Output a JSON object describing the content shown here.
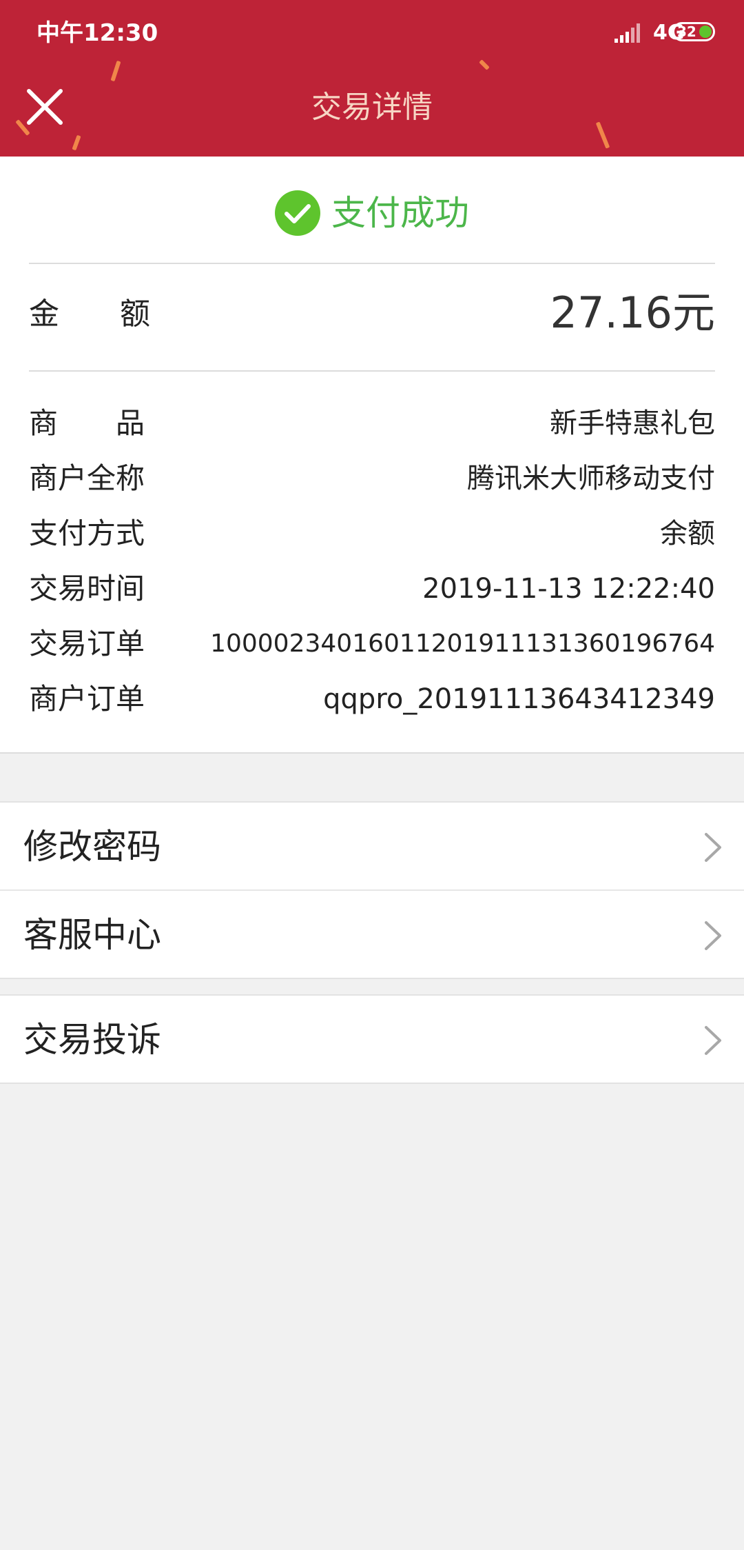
{
  "status_bar": {
    "time": "中午12:30",
    "network": "4G",
    "battery": "32"
  },
  "header": {
    "title": "交易详情",
    "close_icon": "close-icon"
  },
  "result": {
    "icon": "check-circle-icon",
    "text": "支付成功",
    "color": "#4cb64a"
  },
  "amount": {
    "label": "金　　额",
    "value": "27.16元"
  },
  "details": [
    {
      "label": "商　　品",
      "value": "新手特惠礼包"
    },
    {
      "label": "商户全称",
      "value": "腾讯米大师移动支付"
    },
    {
      "label": "支付方式",
      "value": "余额"
    },
    {
      "label": "交易时间",
      "value": "2019-11-13 12:22:40"
    },
    {
      "label": "交易订单",
      "value": "10000234016011201911131360196764"
    },
    {
      "label": "商户订单",
      "value": "qqpro_20191113643412349"
    }
  ],
  "menu": [
    {
      "label": "修改密码",
      "icon": "chevron-right-icon"
    },
    {
      "label": "客服中心",
      "icon": "chevron-right-icon"
    },
    {
      "label": "交易投诉",
      "icon": "chevron-right-icon"
    }
  ],
  "colors": {
    "header_bg": "#be2337",
    "page_bg": "#f1f1f1"
  }
}
